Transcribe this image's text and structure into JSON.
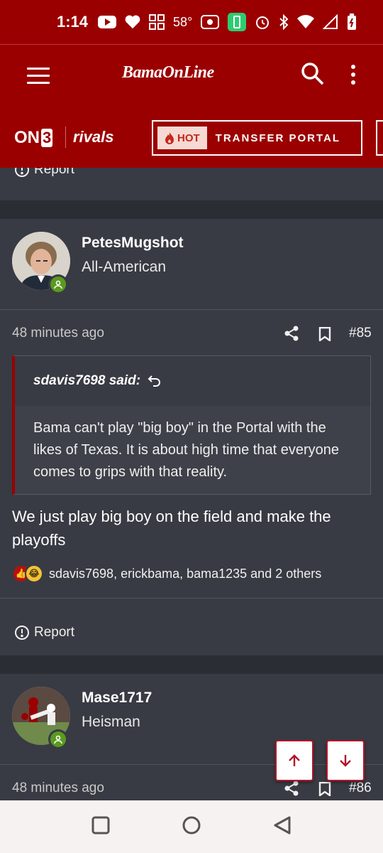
{
  "status_bar": {
    "time": "1:14",
    "temperature": "58°"
  },
  "app_bar": {
    "logo": "BamaOnLine"
  },
  "sub_bar": {
    "on3": "ON",
    "on3_num": "3",
    "rivals": "rivals",
    "hot_label": "HOT",
    "portal_label": "TRANSFER PORTAL"
  },
  "top_report": {
    "label": "Report"
  },
  "posts": [
    {
      "username": "PetesMugshot",
      "title": "All-American",
      "time_ago": "48 minutes ago",
      "number": "#85",
      "quote": {
        "author": "sdavis7698 said:",
        "text": "Bama can't play \"big boy\" in the Portal with the likes of Texas. It is about high time that everyone comes to grips with that reality."
      },
      "body": "We just play big boy on the field and make the playoffs",
      "reactions": "sdavis7698, erickbama, bama1235 and 2 others",
      "report_label": "Report"
    },
    {
      "username": "Mase1717",
      "title": "Heisman",
      "time_ago": "48 minutes ago",
      "number": "#86"
    }
  ],
  "icons": [
    "youtube-icon",
    "heart-icon",
    "widget-icon",
    "radio-icon",
    "battery-saver-icon",
    "alarm-icon",
    "bluetooth-icon",
    "wifi-icon",
    "signal-icon",
    "battery-icon",
    "menu-icon",
    "search-icon",
    "more-icon",
    "fire-icon",
    "report-icon",
    "share-icon",
    "bookmark-icon",
    "reply-icon",
    "like-icon",
    "laugh-icon",
    "arrow-up-icon",
    "arrow-down-icon",
    "square-icon",
    "circle-icon",
    "back-icon"
  ]
}
